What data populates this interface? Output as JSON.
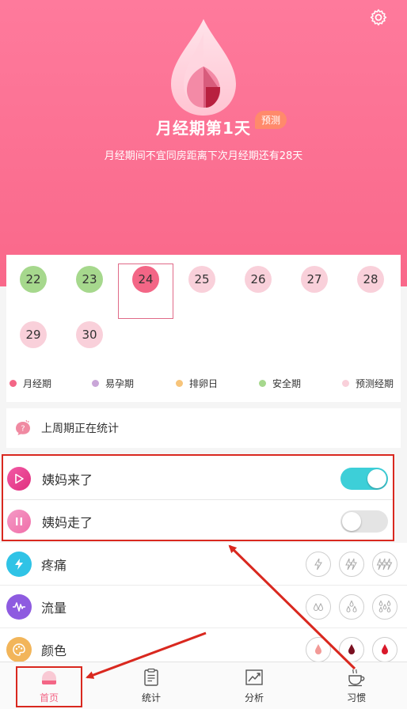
{
  "header": {
    "title": "月经期第1天",
    "badge": "预测",
    "subtitle": "月经期间不宜同房距离下次月经期还有28天"
  },
  "calendar": {
    "days": [
      {
        "label": "22",
        "state": "safe"
      },
      {
        "label": "23",
        "state": "safe"
      },
      {
        "label": "24",
        "state": "today"
      },
      {
        "label": "25",
        "state": "predicted"
      },
      {
        "label": "26",
        "state": "predicted"
      },
      {
        "label": "27",
        "state": "predicted"
      },
      {
        "label": "28",
        "state": "predicted"
      },
      {
        "label": "29",
        "state": "predicted"
      },
      {
        "label": "30",
        "state": "predicted"
      }
    ]
  },
  "legend": [
    {
      "label": "月经期",
      "color": "#f36686"
    },
    {
      "label": "易孕期",
      "color": "#c9a6d8"
    },
    {
      "label": "排卵日",
      "color": "#f7c47a"
    },
    {
      "label": "安全期",
      "color": "#a6d88d"
    },
    {
      "label": "预测经期",
      "color": "#f9d0da"
    }
  ],
  "notice": {
    "text": "上周期正在统计"
  },
  "toggles": [
    {
      "label": "姨妈来了",
      "on": true
    },
    {
      "label": "姨妈走了",
      "on": false
    }
  ],
  "records": [
    {
      "label": "疼痛",
      "icon": "lightning-icon",
      "color": "#2fc3e6",
      "options": [
        "pain-level-1-icon",
        "pain-level-2-icon",
        "pain-level-3-icon"
      ]
    },
    {
      "label": "流量",
      "icon": "waveform-icon",
      "color": "#8e5be0",
      "options": [
        "flow-level-1-icon",
        "flow-level-2-icon",
        "flow-level-3-icon"
      ]
    },
    {
      "label": "颜色",
      "icon": "palette-icon",
      "color": "#f2b55a",
      "options": [
        "color-light-icon",
        "color-dark-icon",
        "color-red-icon"
      ]
    }
  ],
  "tabs": [
    {
      "label": "首页",
      "active": true
    },
    {
      "label": "统计",
      "active": false
    },
    {
      "label": "分析",
      "active": false
    },
    {
      "label": "习惯",
      "active": false
    }
  ],
  "colors": {
    "accent": "#f36686",
    "switch_on": "#3dcfd8",
    "annotation": "#d9281f"
  }
}
